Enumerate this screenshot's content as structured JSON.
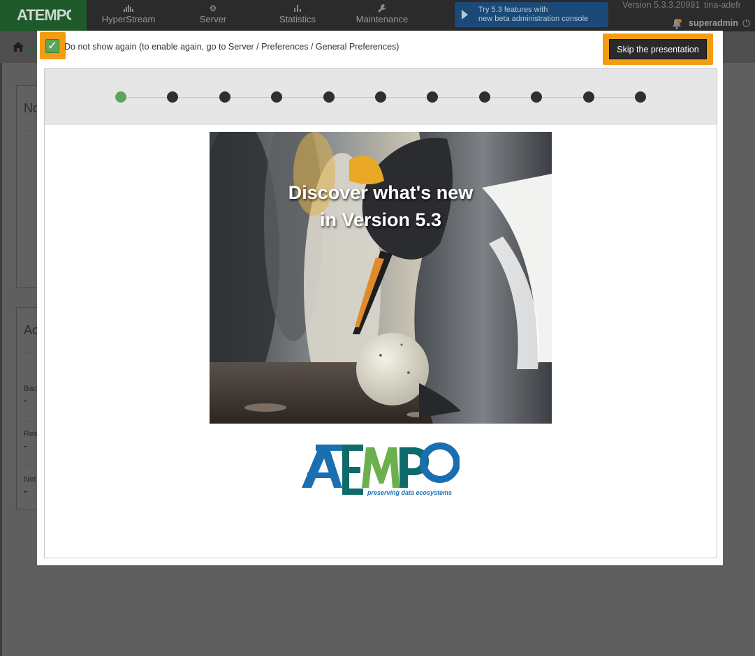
{
  "app": {
    "logo_text": "ATEMPO"
  },
  "nav": {
    "items": [
      {
        "label": "HyperStream",
        "icon": "grid-icon"
      },
      {
        "label": "Server",
        "icon": "gear-icon"
      },
      {
        "label": "Statistics",
        "icon": "bar-chart-icon"
      },
      {
        "label": "Maintenance",
        "icon": "wrench-icon"
      }
    ],
    "beta_line1": "Try 5.3 features with",
    "beta_line2": "new beta administration console",
    "version": "Version 5.3.3.20991",
    "host": "tina-adefr",
    "user": "superadmin"
  },
  "background": {
    "breadcrumb": "H",
    "panel1_title": "No",
    "panel2_title": "Ac",
    "labels": [
      "Bac",
      "Res",
      "Net"
    ],
    "dash": "-"
  },
  "modal": {
    "dont_show_label": "Do not show again (to enable again, go to Server / Preferences / General Preferences)",
    "dont_show_checked": true,
    "skip_label": "Skip the presentation",
    "step_count": 11,
    "active_step": 1,
    "slide_title_line1": "Discover what's new",
    "slide_title_line2": "in Version 5.3",
    "brand_name": "ATEMPO",
    "brand_tagline": "preserving data ecosystems"
  },
  "colors": {
    "accent_orange": "#f39c12",
    "active_green": "#5aa55a",
    "brand_blue": "#1a6fb0",
    "brand_green": "#6ab04c",
    "brand_teal": "#0f6b6b"
  }
}
